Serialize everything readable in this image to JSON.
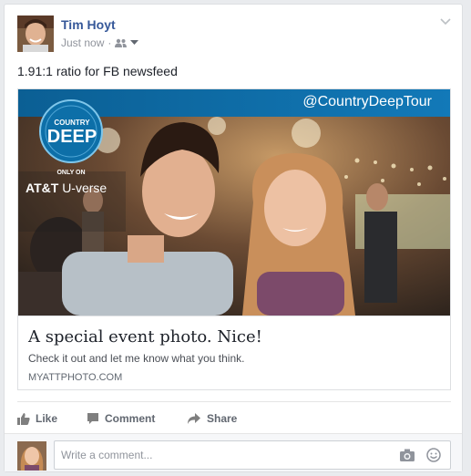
{
  "post": {
    "author": "Tim Hoyt",
    "timestamp": "Just now",
    "text": "1.91:1 ratio for FB newsfeed"
  },
  "preview": {
    "overlay_handle": "@CountryDeepTour",
    "badge_line1": "COUNTRY",
    "badge_line2": "DEEP",
    "only_on": "ONLY ON",
    "att_brand": "AT&T",
    "uverse": "U-verse",
    "title": "A special event photo. Nice!",
    "description": "Check it out and let me know what you think.",
    "domain": "MYATTPHOTO.COM",
    "brand_blue": "#0d6fa8"
  },
  "actions": {
    "like": "Like",
    "comment": "Comment",
    "share": "Share"
  },
  "comment_box": {
    "placeholder": "Write a comment..."
  },
  "colors": {
    "link_blue": "#365899",
    "action_gray": "#616770",
    "border": "#dddfe2"
  },
  "icons": [
    "chevron-down-icon",
    "friends-audience-icon",
    "caret-down-icon",
    "like-thumb-icon",
    "comment-bubble-icon",
    "share-arrow-icon",
    "camera-icon",
    "smiley-icon"
  ]
}
